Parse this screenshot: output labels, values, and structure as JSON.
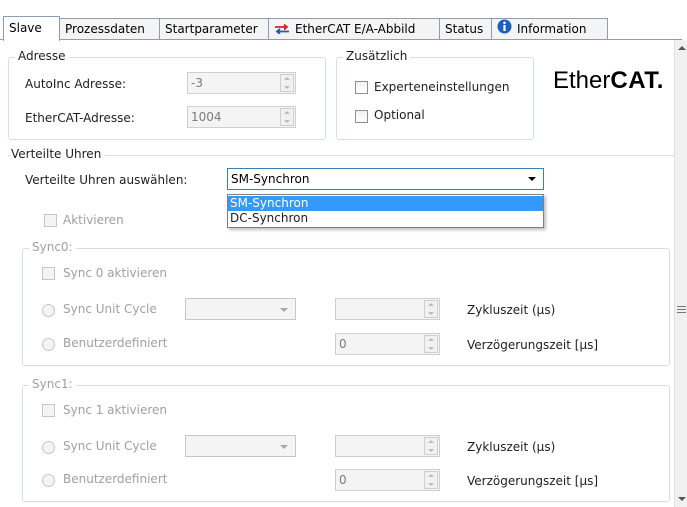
{
  "tabs": [
    {
      "label": "Slave",
      "active": true
    },
    {
      "label": "Prozessdaten"
    },
    {
      "label": "Startparameter"
    },
    {
      "label": "EtherCAT E/A-Abbild",
      "icon": "io-mapping-icon"
    },
    {
      "label": "Status"
    },
    {
      "label": "Information",
      "icon": "info-icon"
    }
  ],
  "adresse": {
    "title": "Adresse",
    "autoinc_label": "AutoInc Adresse:",
    "autoinc_value": "-3",
    "ethercat_label": "EtherCAT-Adresse:",
    "ethercat_value": "1004"
  },
  "zusaetzlich": {
    "title": "Zusätzlich",
    "expert_label": "Experteneinstellungen",
    "optional_label": "Optional"
  },
  "logo": {
    "text_regular": "Ether",
    "text_bold": "CAT."
  },
  "dc": {
    "title": "Verteilte Uhren",
    "select_label": "Verteilte Uhren auswählen:",
    "selected": "SM-Synchron",
    "options": [
      "SM-Synchron",
      "DC-Synchron"
    ],
    "activate_label": "Aktivieren"
  },
  "sync0": {
    "title": "Sync0:",
    "activate_label": "Sync 0 aktivieren",
    "unit_cycle_label": "Sync Unit Cycle",
    "custom_label": "Benutzerdefiniert",
    "cycle_time_label": "Zykluszeit (µs)",
    "delay_label": "Verzögerungszeit [µs]",
    "delay_value": "0"
  },
  "sync1": {
    "title": "Sync1:",
    "activate_label": "Sync 1 aktivieren",
    "unit_cycle_label": "Sync Unit Cycle",
    "custom_label": "Benutzerdefiniert",
    "cycle_time_label": "Zykluszeit (µs)",
    "delay_label": "Verzögerungszeit [µs]",
    "delay_value": "0"
  },
  "colors": {
    "accent": "#3399ff",
    "io_icon_red": "#d4232a",
    "io_icon_blue": "#2259b8",
    "info_icon": "#1c5fbf"
  }
}
